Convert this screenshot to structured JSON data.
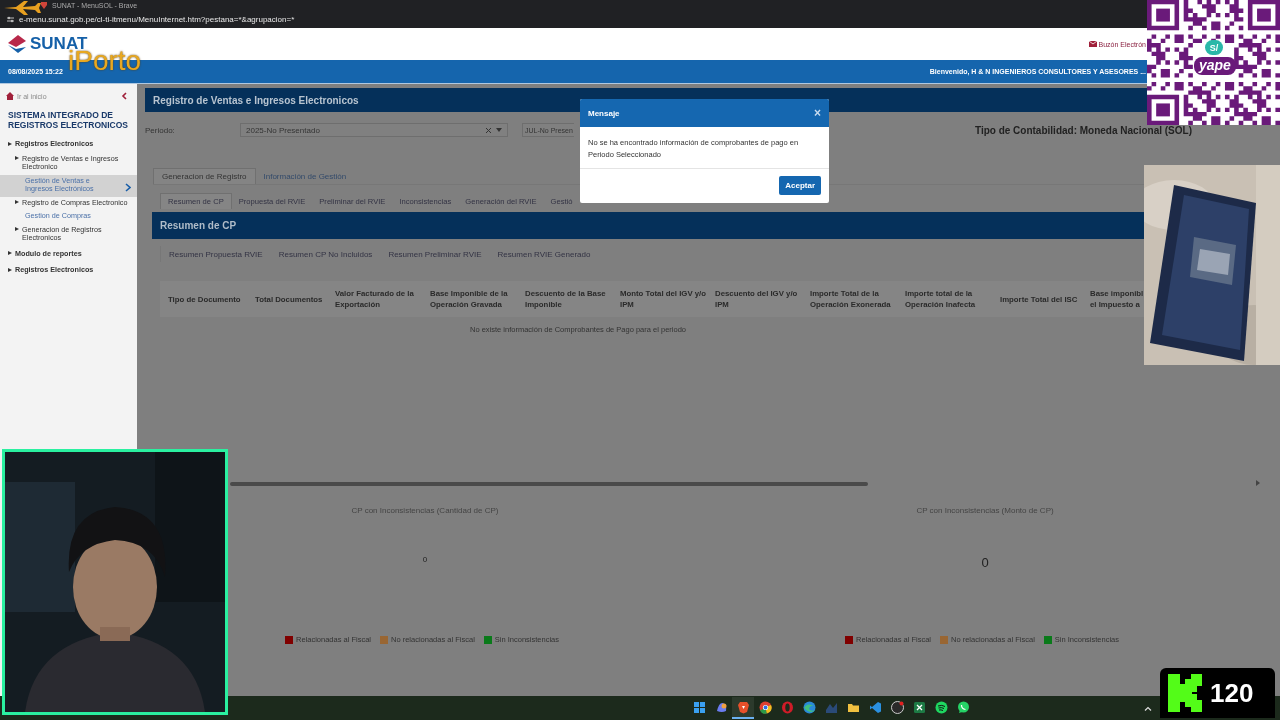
{
  "browser": {
    "title": "SUNAT - MenuSOL - Brave",
    "url": "e-menu.sunat.gob.pe/cl-ti-itmenu/MenuInternet.htm?pestana=*&agrupacion=*"
  },
  "header": {
    "logo": "SUNAT",
    "mailbox": "Buzón Electrón"
  },
  "infobar": {
    "datetime": "08/08/2025 15:22",
    "welcome": "Bienvenido, H & N INGENIEROS CONSULTORES Y ASESORES ..."
  },
  "sidebar": {
    "home": "Ir al inicio",
    "system_title": "SISTEMA INTEGRADO DE REGISTROS ELECTRONICOS",
    "tree": [
      {
        "label": "Registros Electronicos",
        "kind": "folder",
        "selected": false,
        "children": [
          {
            "label": "Registro de Ventas e Ingresos Electronico",
            "kind": "folder",
            "selected": false,
            "children": [
              {
                "label": "Gestión de Ventas e Ingresos Electrónicos",
                "kind": "link",
                "selected": true
              }
            ]
          },
          {
            "label": "Registro de Compras Electronico",
            "kind": "folder",
            "selected": false,
            "children": [
              {
                "label": "Gestion de Compras",
                "kind": "link",
                "selected": false
              }
            ]
          },
          {
            "label": "Generacion de Registros Electronicos",
            "kind": "folder",
            "selected": false
          }
        ]
      },
      {
        "label": "Modulo de reportes",
        "kind": "folder",
        "selected": false
      },
      {
        "label": "Registros Electronicos",
        "kind": "folder",
        "selected": false
      }
    ]
  },
  "page": {
    "title": "Registro de Ventas e Ingresos Electronicos",
    "period_label": "Periodo:",
    "period_value": "2025-No Presentado",
    "month_value": "JUL-No Presen",
    "accounting_type": "Tipo de Contabilidad: Moneda Nacional (SOL)",
    "tabs": [
      {
        "label": "Generacion de Registro",
        "selected": true
      },
      {
        "label": "Información de Gestión",
        "selected": false
      }
    ],
    "subtabs": [
      {
        "label": "Resumen de CP",
        "selected": true
      },
      {
        "label": "Propuesta del RVIE",
        "selected": false
      },
      {
        "label": "Preliminar del RVIE",
        "selected": false
      },
      {
        "label": "Inconsistencias",
        "selected": false
      },
      {
        "label": "Generación del RVIE",
        "selected": false
      },
      {
        "label": "Gestió",
        "selected": false
      }
    ],
    "section_title": "Resumen de CP",
    "summary_tabs": [
      "Resumen Propuesta RVIE",
      "Resumen CP No Incluidos",
      "Resumen Preliminar RVIE",
      "Resumen RVIE Generado"
    ],
    "table": {
      "columns": [
        "Tipo de Documento",
        "Total Documentos",
        "Valor Facturado de la Exportación",
        "Base Imponible de la Operación Gravada",
        "Descuento de la Base Imponible",
        "Monto Total del IGV y/o IPM",
        "Descuento del IGV y/o IPM",
        "Importe Total de la Operación Exonerada",
        "Importe total de la Operación Inafecta",
        "Importe Total del ISC",
        "Base imponibl el Impuesto a"
      ],
      "empty_message": "No existe información de Comprobantes de Pago para el periodo"
    },
    "charts": [
      {
        "title": "CP con Inconsistencias (Cantidad de CP)",
        "total": "0",
        "emphasized": false,
        "legend": [
          {
            "label": "Relacionadas al Fiscal",
            "color": "#800000"
          },
          {
            "label": "No relacionadas al Fiscal",
            "color": "#996633"
          },
          {
            "label": "Sin Inconsistencias",
            "color": "#0a7a1a"
          }
        ]
      },
      {
        "title": "CP con Inconsistencias (Monto de CP)",
        "total": "0",
        "emphasized": true,
        "legend": [
          {
            "label": "Relacionadas al Fiscal",
            "color": "#800000"
          },
          {
            "label": "No relacionadas al Fiscal",
            "color": "#996633"
          },
          {
            "label": "Sin Inconsistencias",
            "color": "#0a7a1a"
          }
        ]
      }
    ]
  },
  "dialog": {
    "title": "Mensaje",
    "close": "×",
    "message": "No se ha encontrado información de comprobantes de pago en Periodo Seleccionado",
    "button": "Aceptar"
  },
  "taskbar": {
    "apps": [
      {
        "kind": "windows",
        "selected": false
      },
      {
        "kind": "copilot",
        "selected": false
      },
      {
        "kind": "brave",
        "selected": true
      },
      {
        "kind": "chrome",
        "selected": false
      },
      {
        "kind": "opera",
        "selected": false
      },
      {
        "kind": "edge",
        "selected": false
      },
      {
        "kind": "steam",
        "selected": false
      },
      {
        "kind": "files",
        "selected": false
      },
      {
        "kind": "code",
        "selected": false
      },
      {
        "kind": "obs",
        "selected": false
      },
      {
        "kind": "excel",
        "selected": false
      },
      {
        "kind": "spotify",
        "selected": false
      },
      {
        "kind": "whatsapp",
        "selected": false
      }
    ]
  },
  "overlays": {
    "brand": "iPorto",
    "qr": {
      "currency": "S/",
      "label": "yape"
    },
    "viewer_count": "120"
  }
}
